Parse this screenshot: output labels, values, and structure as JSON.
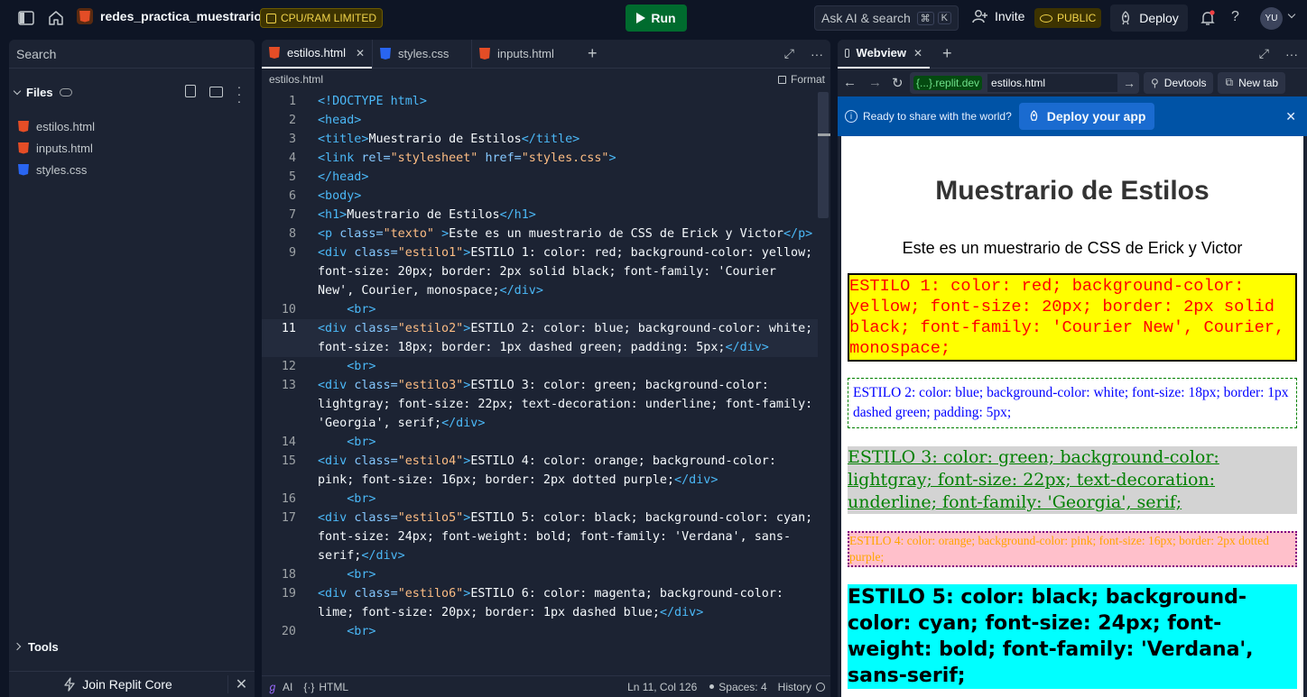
{
  "topbar": {
    "project_name": "redes_practica_muestrario",
    "resource_badge": "CPU/RAM LIMITED",
    "run_label": "Run",
    "ask_ai_label": "Ask AI & search",
    "shortcut_keys": [
      "⌘",
      "K"
    ],
    "invite_label": "Invite",
    "public_label": "PUBLIC",
    "deploy_label": "Deploy",
    "avatar_initials": "YU"
  },
  "sidebar": {
    "search_placeholder": "Search",
    "files_title": "Files",
    "files": [
      {
        "name": "estilos.html",
        "type": "html"
      },
      {
        "name": "inputs.html",
        "type": "html"
      },
      {
        "name": "styles.css",
        "type": "css"
      }
    ],
    "tools_label": "Tools",
    "join_label": "Join Replit Core"
  },
  "editor": {
    "tabs": [
      {
        "label": "estilos.html",
        "type": "html",
        "active": true
      },
      {
        "label": "styles.css",
        "type": "css",
        "active": false
      },
      {
        "label": "inputs.html",
        "type": "html",
        "active": false
      }
    ],
    "breadcrumb": "estilos.html",
    "format_label": "Format",
    "lines": [
      {
        "n": "1",
        "html": "<span class=\"tg\">&lt;!DOCTYPE html&gt;</span>"
      },
      {
        "n": "2",
        "html": "<span class=\"tg\">&lt;head&gt;</span>"
      },
      {
        "n": "3",
        "html": "<span class=\"tg\">&lt;title&gt;</span>Muestrario de Estilos<span class=\"tg\">&lt;/title&gt;</span>"
      },
      {
        "n": "4",
        "html": "<span class=\"tg\">&lt;link</span> <span class=\"at\">rel=</span><span class=\"st\">\"stylesheet\"</span> <span class=\"at\">href=</span><span class=\"st\">\"styles.css\"</span><span class=\"tg\">&gt;</span>"
      },
      {
        "n": "5",
        "html": "<span class=\"tg\">&lt;/head&gt;</span>"
      },
      {
        "n": "6",
        "html": "<span class=\"tg\">&lt;body&gt;</span>"
      },
      {
        "n": "7",
        "html": "<span class=\"tg\">&lt;h1&gt;</span>Muestrario de Estilos<span class=\"tg\">&lt;/h1&gt;</span>"
      },
      {
        "n": "8",
        "html": "<span class=\"tg\">&lt;p</span> <span class=\"at\">class=</span><span class=\"st\">\"texto\"</span> <span class=\"tg\">&gt;</span>Este es un muestrario de CSS de Erick y Victor<span class=\"tg\">&lt;/p&gt;</span>"
      },
      {
        "n": "9",
        "html": "<span class=\"tg\">&lt;div</span> <span class=\"at\">class=</span><span class=\"st\">\"estilo1\"</span><span class=\"tg\">&gt;</span>ESTILO 1: color: red; background-color: yellow; font-size: 20px; border: 2px solid black; font-family: 'Courier New', Courier, monospace;<span class=\"tg\">&lt;/div&gt;</span>"
      },
      {
        "n": "10",
        "html": "    <span class=\"tg\">&lt;br&gt;</span>"
      },
      {
        "n": "11",
        "cur": true,
        "html": "<span class=\"tg\">&lt;div</span> <span class=\"at\">class=</span><span class=\"st\">\"estilo2\"</span><span class=\"tg\">&gt;</span>ESTILO 2: color: blue; background-color: white; font-size: 18px; border: 1px dashed green; padding: 5px;<span class=\"tg\">&lt;/div&gt;</span>"
      },
      {
        "n": "12",
        "html": "    <span class=\"tg\">&lt;br&gt;</span>"
      },
      {
        "n": "13",
        "html": "<span class=\"tg\">&lt;div</span> <span class=\"at\">class=</span><span class=\"st\">\"estilo3\"</span><span class=\"tg\">&gt;</span>ESTILO 3: color: green; background-color: lightgray; font-size: 22px; text-decoration: underline; font-family: 'Georgia', serif;<span class=\"tg\">&lt;/div&gt;</span>"
      },
      {
        "n": "14",
        "html": "    <span class=\"tg\">&lt;br&gt;</span>"
      },
      {
        "n": "15",
        "html": "<span class=\"tg\">&lt;div</span> <span class=\"at\">class=</span><span class=\"st\">\"estilo4\"</span><span class=\"tg\">&gt;</span>ESTILO 4: color: orange; background-color: pink; font-size: 16px; border: 2px dotted purple;<span class=\"tg\">&lt;/div&gt;</span>"
      },
      {
        "n": "16",
        "html": "    <span class=\"tg\">&lt;br&gt;</span>"
      },
      {
        "n": "17",
        "html": "<span class=\"tg\">&lt;div</span> <span class=\"at\">class=</span><span class=\"st\">\"estilo5\"</span><span class=\"tg\">&gt;</span>ESTILO 5: color: black; background-color: cyan; font-size: 24px; font-weight: bold; font-family: 'Verdana', sans-serif;<span class=\"tg\">&lt;/div&gt;</span>"
      },
      {
        "n": "18",
        "html": "    <span class=\"tg\">&lt;br&gt;</span>"
      },
      {
        "n": "19",
        "html": "<span class=\"tg\">&lt;div</span> <span class=\"at\">class=</span><span class=\"st\">\"estilo6\"</span><span class=\"tg\">&gt;</span>ESTILO 6: color: magenta; background-color: lime; font-size: 20px; border: 1px dashed blue;<span class=\"tg\">&lt;/div&gt;</span>"
      },
      {
        "n": "20",
        "html": "    <span class=\"tg\">&lt;br&gt;</span>"
      }
    ],
    "status": {
      "ai": "AI",
      "lang": "HTML",
      "cursor": "Ln 11, Col 126",
      "spaces": "Spaces: 4",
      "history": "History"
    }
  },
  "webview": {
    "tab_label": "Webview",
    "url_domain": "{...}.replit.dev",
    "url_path": "estilos.html",
    "devtools_label": "Devtools",
    "newtab_label": "New tab",
    "banner_text": "Ready to share with the world?",
    "banner_button": "Deploy your app",
    "page": {
      "h1": "Muestrario de Estilos",
      "p": "Este es un muestrario de CSS de Erick y Victor",
      "estilo1": "ESTILO 1: color: red; background-color: yellow; font-size: 20px; border: 2px solid black; font-family: 'Courier New', Courier, monospace;",
      "estilo2": "ESTILO 2: color: blue; background-color: white; font-size: 18px; border: 1px dashed green; padding: 5px;",
      "estilo3": "ESTILO 3: color: green; background-color: lightgray; font-size: 22px; text-decoration: underline; font-family: 'Georgia', serif;",
      "estilo4": "ESTILO 4: color: orange; background-color: pink; font-size: 16px; border: 2px dotted purple;",
      "estilo5": "ESTILO 5: color: black; background-color: cyan; font-size: 24px; font-weight: bold; font-family: 'Verdana', sans-serif;"
    }
  },
  "colors": {
    "bg": "#0e1525",
    "panel": "#1c2333",
    "run_green": "#006b2e",
    "accent_blue": "#0053a6",
    "badge_yellow": "#a58e00"
  }
}
